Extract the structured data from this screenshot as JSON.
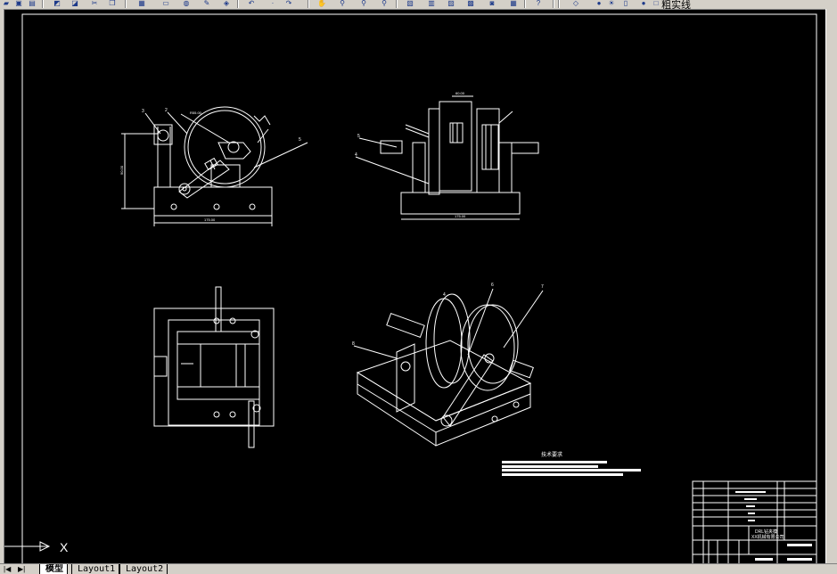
{
  "app": {
    "colors": {
      "canvas": "#000000",
      "line": "#ffffff",
      "chrome": "#d4d0c8",
      "accent": "#1d3a8a"
    }
  },
  "toolbar": {
    "icons": [
      "open-icon",
      "save-icon",
      "print-icon",
      "plot-preview-icon",
      "publish-icon",
      "cut-icon",
      "copy-icon",
      "paste-icon",
      "match-properties-icon",
      "block-editor-icon",
      "undo-icon",
      "redo-icon",
      "pan-icon",
      "zoom-realtime-icon",
      "zoom-window-icon",
      "zoom-previous-icon",
      "properties-icon",
      "design-center-icon",
      "tool-palettes-icon",
      "sheet-set-icon",
      "markup-icon",
      "quickcalc-icon",
      "help-icon",
      "layer-manager-icon",
      "layer-on-icon",
      "layer-freeze-icon",
      "layer-color-icon"
    ],
    "layer_name": "粗实线"
  },
  "drawing": {
    "tech_req_title": "技术要求",
    "front_view": {
      "dim_height": "90.00",
      "dim_width": "175.00",
      "dim_radius": "R55.00",
      "balloons": [
        "3",
        "2",
        "1",
        "5"
      ]
    },
    "side_view": {
      "dim_top": "60.00",
      "dim_width": "175.00",
      "balloons": [
        "5",
        "4"
      ]
    },
    "iso_view": {
      "balloons": [
        "4",
        "8",
        "6",
        "7"
      ]
    },
    "title_block": {
      "title_line1": "DRL钻夹模",
      "title_line2": "XX机械有限公司"
    }
  },
  "ucs": {
    "x_label": "X"
  },
  "tabs": {
    "nav": [
      "|◀",
      "◀",
      "▶",
      "▶|"
    ],
    "items": [
      {
        "label": "模型",
        "active": true
      },
      {
        "label": "Layout1",
        "active": false
      },
      {
        "label": "Layout2",
        "active": false
      }
    ]
  }
}
